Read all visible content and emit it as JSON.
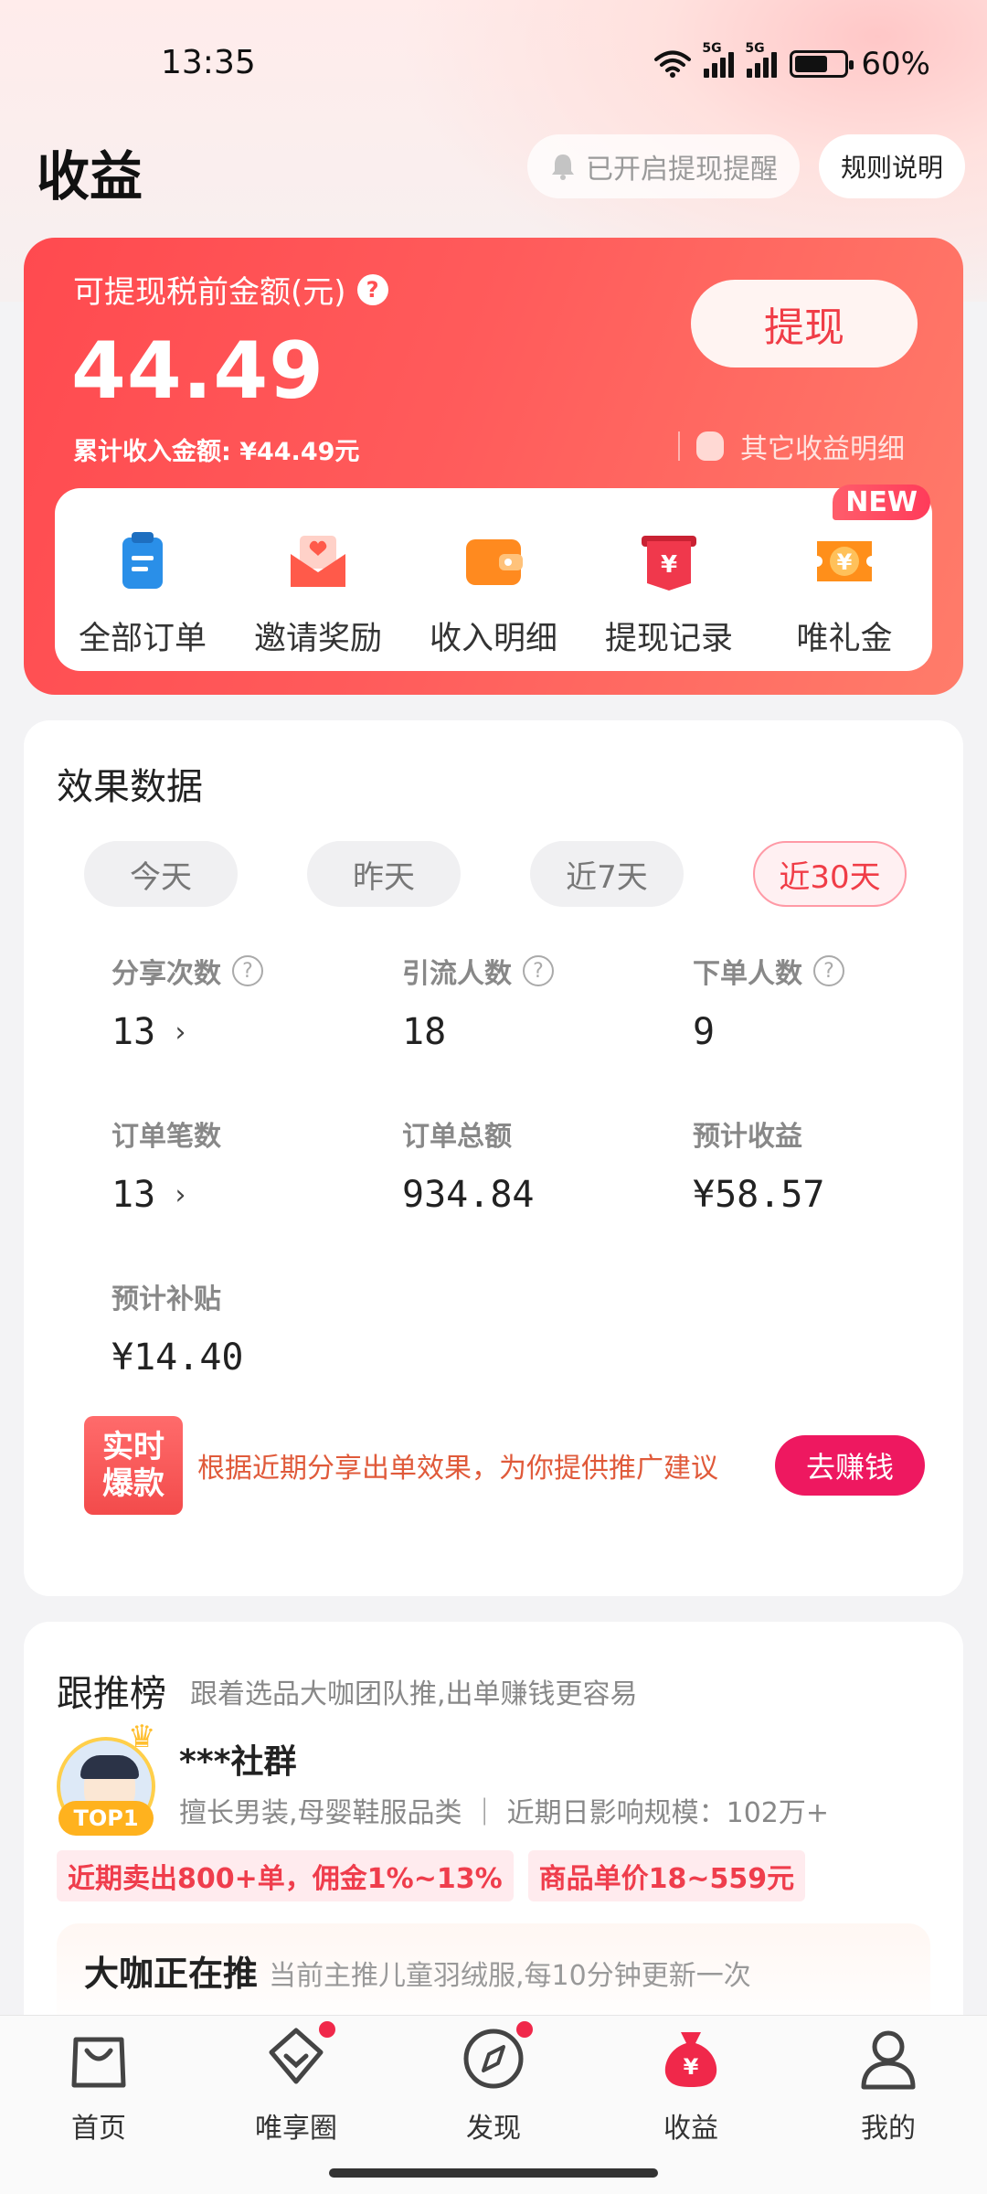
{
  "status_bar": {
    "time": "13:35",
    "battery": "60%",
    "battery_level": 0.6
  },
  "header": {
    "title": "收益",
    "remind_label": "已开启提现提醒",
    "rules_label": "规则说明"
  },
  "balance_card": {
    "label": "可提现税前金额(元)",
    "amount": "44.49",
    "cumulative": "累计收入金额: ¥44.49元",
    "withdraw_label": "提现",
    "other_details": "其它收益明细"
  },
  "quick_actions": [
    {
      "label": "全部订单",
      "icon": "clipboard-icon",
      "color": "#2a8fe8"
    },
    {
      "label": "邀请奖励",
      "icon": "envelope-heart-icon",
      "color": "#ff5a4a"
    },
    {
      "label": "收入明细",
      "icon": "wallet-icon",
      "color": "#ff8a1f"
    },
    {
      "label": "提现记录",
      "icon": "yuan-receipt-icon",
      "color": "#f0384c"
    },
    {
      "label": "唯礼金",
      "icon": "yuan-coupon-icon",
      "color": "#ff8f1a",
      "badge": "NEW"
    }
  ],
  "performance": {
    "title": "效果数据",
    "tabs": [
      "今天",
      "昨天",
      "近7天",
      "近30天"
    ],
    "active_tab": "近30天",
    "stats": [
      {
        "label": "分享次数",
        "value": "13",
        "help": true,
        "chevron": true
      },
      {
        "label": "引流人数",
        "value": "18",
        "help": true
      },
      {
        "label": "下单人数",
        "value": "9",
        "help": true
      },
      {
        "label": "订单笔数",
        "value": "13",
        "chevron": true
      },
      {
        "label": "订单总额",
        "value": "934.84"
      },
      {
        "label": "预计收益",
        "value": "¥58.57"
      },
      {
        "label": "预计补贴",
        "value": "¥14.40"
      }
    ],
    "tip": {
      "badge_line1": "实时",
      "badge_line2": "爆款",
      "text": "根据近期分享出单效果，为你提供推广建议",
      "button": "去赚钱"
    }
  },
  "ranking": {
    "title": "跟推榜",
    "subtitle": "跟着选品大咖团队推,出单赚钱更容易",
    "group": {
      "name": "***社群",
      "rank": "TOP1",
      "desc": "擅长男装,母婴鞋服品类 ｜ 近期日影响规模：102万+"
    },
    "chips": [
      "近期卖出800+单，佣金1%~13%",
      "商品单价18~559元"
    ],
    "pushing": {
      "title": "大咖正在推",
      "subtitle": "当前主推儿童羽绒服,每10分钟更新一次"
    }
  },
  "bottom_nav": [
    {
      "label": "首页",
      "icon": "bag-icon"
    },
    {
      "label": "唯享圈",
      "icon": "diamond-icon",
      "dot": true
    },
    {
      "label": "发现",
      "icon": "compass-icon",
      "dot": true
    },
    {
      "label": "收益",
      "icon": "money-bag-icon",
      "active": true
    },
    {
      "label": "我的",
      "icon": "person-icon"
    }
  ]
}
